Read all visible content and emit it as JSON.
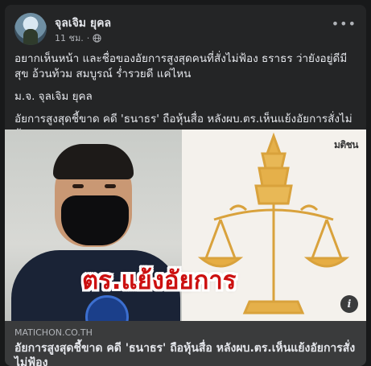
{
  "post": {
    "author": "จุลเจิม ยุคล",
    "time": "11 ชม.",
    "separator": "·",
    "more_label": "•••",
    "text_line1": "อยากเห็นหน้า และชื่อของอัยการสูงสุดคนที่สั่งไม่ฟ้อง ธราธร ว่ายังอยู่ดีมีสุข อ้วนท้วม สมบูรณ์ ร่ำรวยดี แค่ไหน",
    "text_line2": "ม.จ. จุลเจิม ยุคล",
    "text_line3": "อัยการสูงสุดชี้ขาด คดี 'ธนาธร' ถือหุ้นสื่อ หลังผบ.ตร.เห็นแย้งอัยการสั่งไม่ฟ้อง"
  },
  "media": {
    "overlay_text": "ตร.แย้งอัยการ",
    "watermark": "มติชน",
    "info_label": "i"
  },
  "link_preview": {
    "domain": "MATICHON.CO.TH",
    "title": "อัยการสูงสุดชี้ขาด คดี 'ธนาธร' ถือหุ้นสื่อ หลังผบ.ตร.เห็นแย้งอัยการสั่งไม่ฟ้อง"
  },
  "icons": {
    "globe": "globe-icon",
    "more": "more-icon",
    "info": "info-icon"
  },
  "colors": {
    "background": "#18191a",
    "card": "#242526",
    "text_primary": "#e4e6eb",
    "text_secondary": "#b0b3b8",
    "overlay_red": "#cc1010",
    "emblem_gold": "#d9a23c"
  }
}
